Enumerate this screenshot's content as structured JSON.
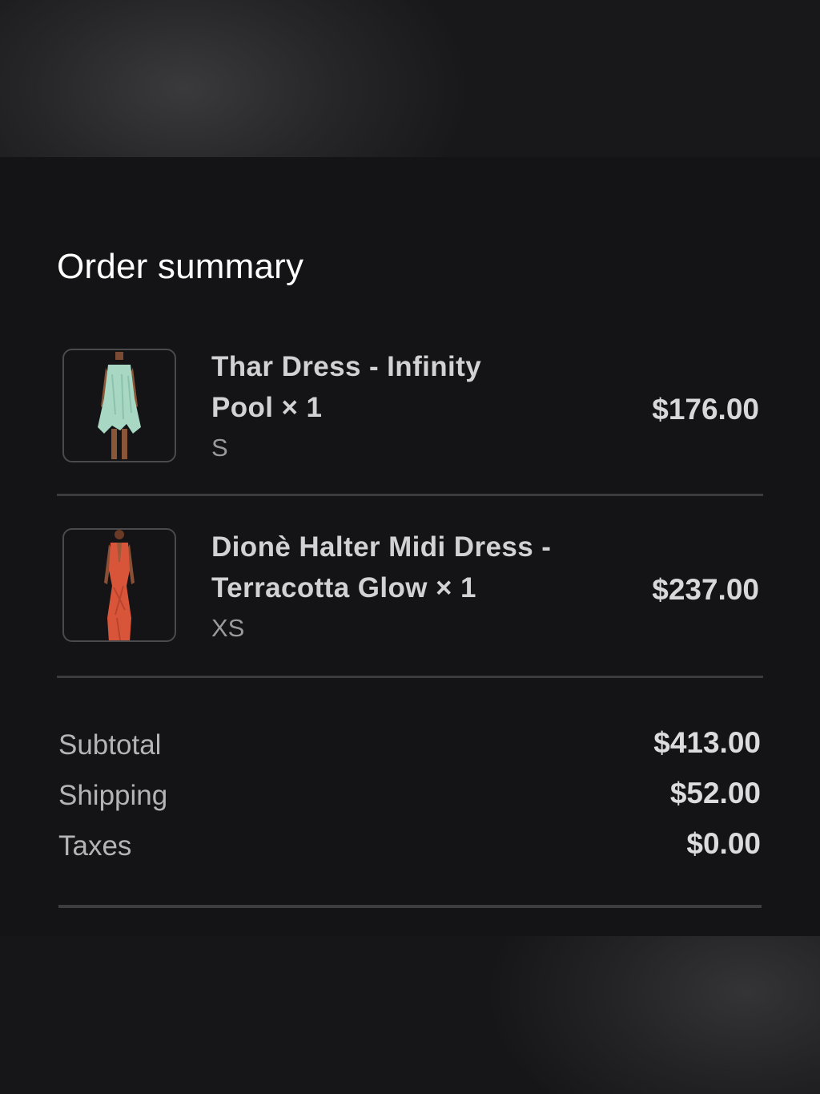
{
  "order_summary": {
    "title": "Order summary",
    "items": [
      {
        "name": "Thar Dress - Infinity Pool × 1",
        "name_line1": "Thar Dress - Infinity",
        "name_line2": "Pool × 1",
        "variant": "S",
        "price": "$176.00",
        "image_color": "#a8d8c4"
      },
      {
        "name": "Dionè Halter Midi Dress - Terracotta Glow × 1",
        "name_line1": "Dionè Halter Midi Dress -",
        "name_line2": "Terracotta Glow × 1",
        "variant": "XS",
        "price": "$237.00",
        "image_color": "#d9553a"
      }
    ],
    "totals": {
      "subtotal_label": "Subtotal",
      "subtotal_value": "$413.00",
      "shipping_label": "Shipping",
      "shipping_value": "$52.00",
      "taxes_label": "Taxes",
      "taxes_value": "$0.00"
    }
  },
  "colors": {
    "background": "#141416",
    "divider": "#3b3b3d",
    "title_text": "#ffffff",
    "primary_text": "#d2d2d4",
    "secondary_text": "#9a9a9c"
  }
}
